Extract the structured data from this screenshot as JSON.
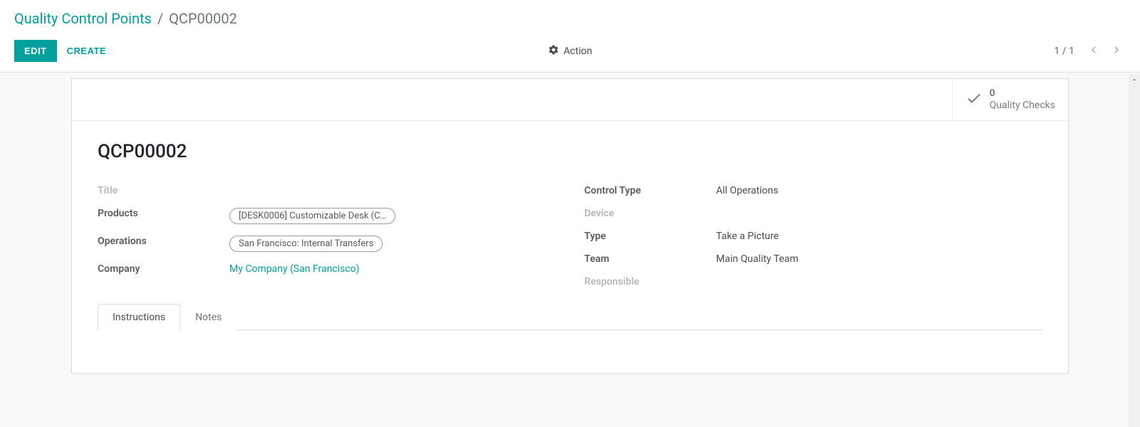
{
  "breadcrumb": {
    "root": "Quality Control Points",
    "sep": "/",
    "current": "QCP00002"
  },
  "toolbar": {
    "edit_label": "Edit",
    "create_label": "Create",
    "action_label": "Action"
  },
  "pager": {
    "text": "1 / 1"
  },
  "stat": {
    "count": "0",
    "label": "Quality Checks"
  },
  "record": {
    "title": "QCP00002",
    "left": {
      "title_label": "Title",
      "title_value": "",
      "products_label": "Products",
      "products_value": "[DESK0006] Customizable Desk (C…",
      "operations_label": "Operations",
      "operations_value": "San Francisco: Internal Transfers",
      "company_label": "Company",
      "company_value": "My Company (San Francisco)"
    },
    "right": {
      "control_type_label": "Control Type",
      "control_type_value": "All Operations",
      "device_label": "Device",
      "device_value": "",
      "type_label": "Type",
      "type_value": "Take a Picture",
      "team_label": "Team",
      "team_value": "Main Quality Team",
      "responsible_label": "Responsible",
      "responsible_value": ""
    }
  },
  "tabs": {
    "instructions": "Instructions",
    "notes": "Notes"
  }
}
